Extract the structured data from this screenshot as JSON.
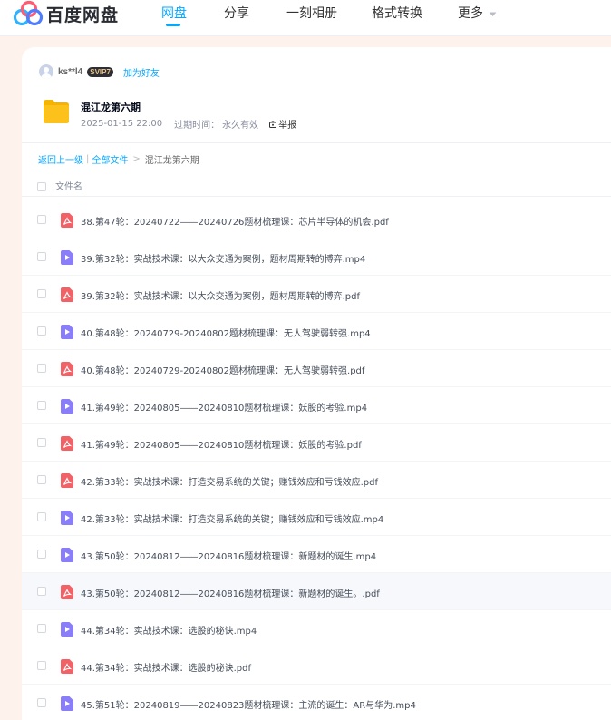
{
  "app": {
    "logo_text": "百度网盘"
  },
  "nav": [
    {
      "label": "网盘",
      "active": true
    },
    {
      "label": "分享"
    },
    {
      "label": "一刻相册"
    },
    {
      "label": "格式转换"
    },
    {
      "label": "更多"
    }
  ],
  "user": {
    "name": "ks**l4",
    "badge": "SVIP7",
    "add_friend": "加为好友"
  },
  "share": {
    "title": "混江龙第六期",
    "date": "2025-01-15 22:00",
    "expire_label": "过期时间：",
    "expire_value": "永久有效",
    "report": "举报"
  },
  "breadcrumb": {
    "back": "返回上一级",
    "all_files": "全部文件",
    "sep": ">",
    "current": "混江龙第六期"
  },
  "list_header": {
    "name": "文件名"
  },
  "files": [
    {
      "name": "38.第47轮：20240722——20240726题材梳理课：芯片半导体的机会.pdf",
      "type": "pdf"
    },
    {
      "name": "39.第32轮：实战技术课：以大众交通为案例，题材周期转的博弈.mp4",
      "type": "video"
    },
    {
      "name": "39.第32轮：实战技术课：以大众交通为案例，题材周期转的博弈.pdf",
      "type": "pdf"
    },
    {
      "name": "40.第48轮：20240729-20240802题材梳理课：无人驾驶弱转强.mp4",
      "type": "video"
    },
    {
      "name": "40.第48轮：20240729-20240802题材梳理课：无人驾驶弱转强.pdf",
      "type": "pdf"
    },
    {
      "name": "41.第49轮：20240805——20240810题材梳理课：妖股的考验.mp4",
      "type": "video"
    },
    {
      "name": "41.第49轮：20240805——20240810题材梳理课：妖股的考验.pdf",
      "type": "pdf"
    },
    {
      "name": "42.第33轮：实战技术课：打造交易系统的关键；赚钱效应和亏钱效应.pdf",
      "type": "pdf"
    },
    {
      "name": "42.第33轮：实战技术课：打造交易系统的关键；赚钱效应和亏钱效应.mp4",
      "type": "video"
    },
    {
      "name": "43.第50轮：20240812——20240816题材梳理课：新题材的诞生.mp4",
      "type": "video"
    },
    {
      "name": "43.第50轮：20240812——20240816题材梳理课：新题材的诞生。.pdf",
      "type": "pdf",
      "hover": true
    },
    {
      "name": "44.第34轮：实战技术课：选股的秘诀.mp4",
      "type": "video"
    },
    {
      "name": "44.第34轮：实战技术课：选股的秘诀.pdf",
      "type": "pdf"
    },
    {
      "name": "45.第51轮：20240819——20240823题材梳理课：主流的诞生：AR与华为.mp4",
      "type": "video"
    }
  ],
  "colors": {
    "accent": "#06a7ff",
    "pdf": "#f26166",
    "video": "#8a7dfa",
    "folder": "#fcc21b"
  }
}
